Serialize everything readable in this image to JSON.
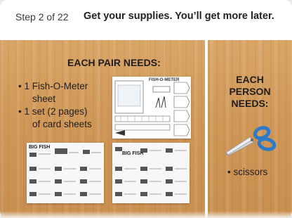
{
  "header": {
    "step": "Step 2 of 22",
    "title": "Get your supplies. You’ll get more later."
  },
  "pair": {
    "heading": "EACH PAIR NEEDS:",
    "items": [
      "• 1 Fish-O-Meter",
      "sheet",
      "• 1 set (2 pages)",
      "of card sheets"
    ]
  },
  "meter_sheet": {
    "title": "FISH-O-METER"
  },
  "card_sheets": {
    "labels": [
      "BIG FISH",
      "BIG FISH"
    ]
  },
  "person": {
    "heading_lines": [
      "EACH",
      "PERSON",
      "NEEDS:"
    ],
    "item": "• scissors",
    "scissors_color": "#2f79c9"
  }
}
